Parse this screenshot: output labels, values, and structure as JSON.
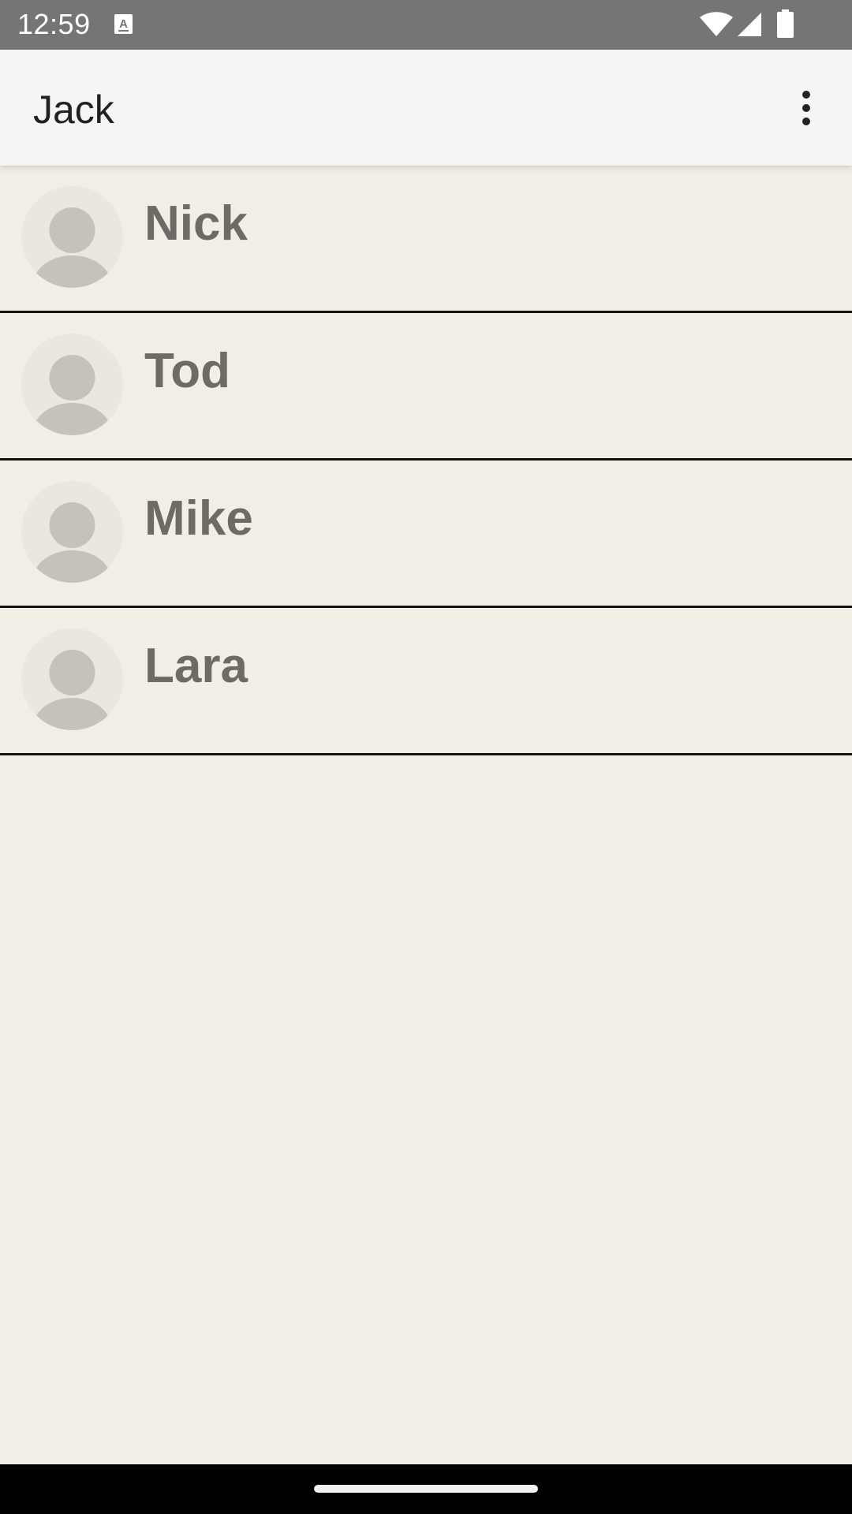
{
  "status_bar": {
    "time": "12:59",
    "notification_icon": "text-a-icon",
    "wifi_icon": "wifi-icon",
    "signal_icon": "cell-signal-icon",
    "battery_icon": "battery-icon"
  },
  "app_bar": {
    "title": "Jack",
    "overflow_icon": "more-vert-icon"
  },
  "contacts": [
    {
      "name": "Nick",
      "avatar_icon": "person-avatar-icon"
    },
    {
      "name": "Tod",
      "avatar_icon": "person-avatar-icon"
    },
    {
      "name": "Mike",
      "avatar_icon": "person-avatar-icon"
    },
    {
      "name": "Lara",
      "avatar_icon": "person-avatar-icon"
    }
  ],
  "colors": {
    "status_bar": "#757575",
    "app_bar": "#f5f5f5",
    "background": "#f2eee5",
    "name_text": "#6d6b65",
    "avatar_background": "#ebe7e0",
    "avatar_figure": "#c6c2bb",
    "divider": "#111111"
  }
}
